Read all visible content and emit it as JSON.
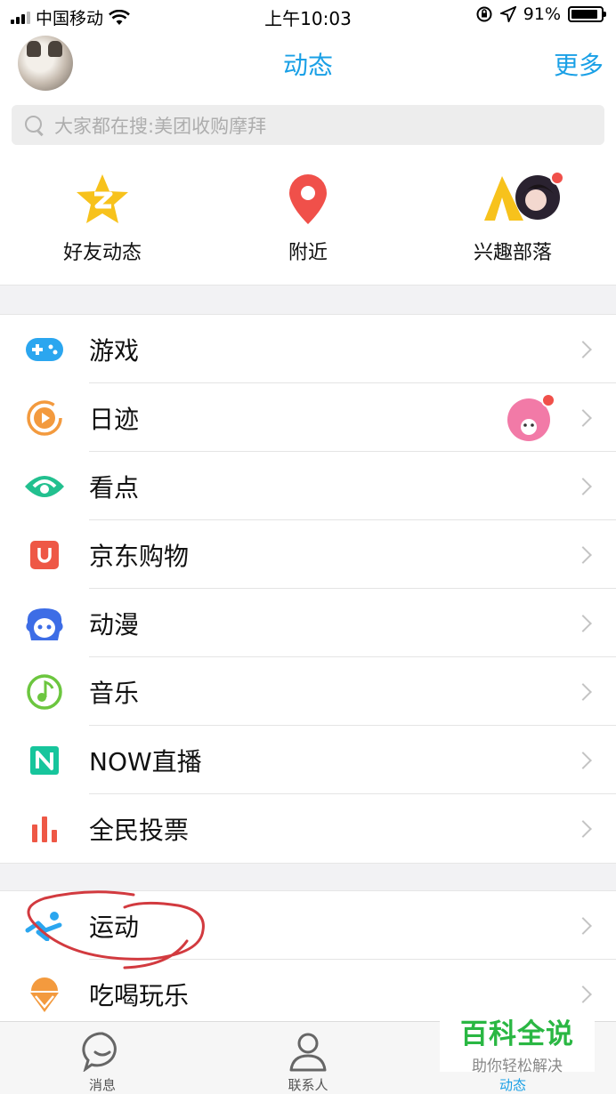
{
  "status_bar": {
    "carrier": "中国移动",
    "time": "上午10:03",
    "battery": "91%",
    "battery_level": 0.91
  },
  "nav": {
    "title": "动态",
    "more": "更多"
  },
  "search": {
    "placeholder": "大家都在搜:美团收购摩拜"
  },
  "quick": [
    {
      "label": "好友动态",
      "icon": "qzone-star-icon",
      "color": "#f7c21c"
    },
    {
      "label": "附近",
      "icon": "location-pin-icon",
      "color": "#f0504a"
    },
    {
      "label": "兴趣部落",
      "icon": "tribe-tent-icon",
      "color": "#f7c21c"
    }
  ],
  "section1": [
    {
      "label": "游戏",
      "icon": "gamepad-icon",
      "color": "#2ba6ef"
    },
    {
      "label": "日迹",
      "icon": "play-circle-icon",
      "color": "#f39a3e"
    },
    {
      "label": "看点",
      "icon": "eye-icon",
      "color": "#22c08f"
    },
    {
      "label": "京东购物",
      "icon": "shopping-bag-icon",
      "color": "#ee5846"
    },
    {
      "label": "动漫",
      "icon": "anime-face-icon",
      "color": "#3d6de6"
    },
    {
      "label": "音乐",
      "icon": "music-note-icon",
      "color": "#6cc63f"
    },
    {
      "label": "NOW直播",
      "icon": "now-live-icon",
      "color": "#17c59c"
    },
    {
      "label": "全民投票",
      "icon": "bar-chart-icon",
      "color": "#ee5846"
    }
  ],
  "section2": [
    {
      "label": "运动",
      "icon": "runner-icon",
      "color": "#2ba6ef"
    },
    {
      "label": "吃喝玩乐",
      "icon": "ice-cream-icon",
      "color": "#f39a3e"
    }
  ],
  "tabs": [
    {
      "label": "消息",
      "icon": "chat-bubble-icon",
      "active": false
    },
    {
      "label": "联系人",
      "icon": "contact-person-icon",
      "active": false
    },
    {
      "label": "动态",
      "icon": "star-icon",
      "active": true
    }
  ],
  "watermark": {
    "title": "百科全说",
    "subtitle": "助你轻松解决"
  },
  "accent_color": "#1aa0e6"
}
